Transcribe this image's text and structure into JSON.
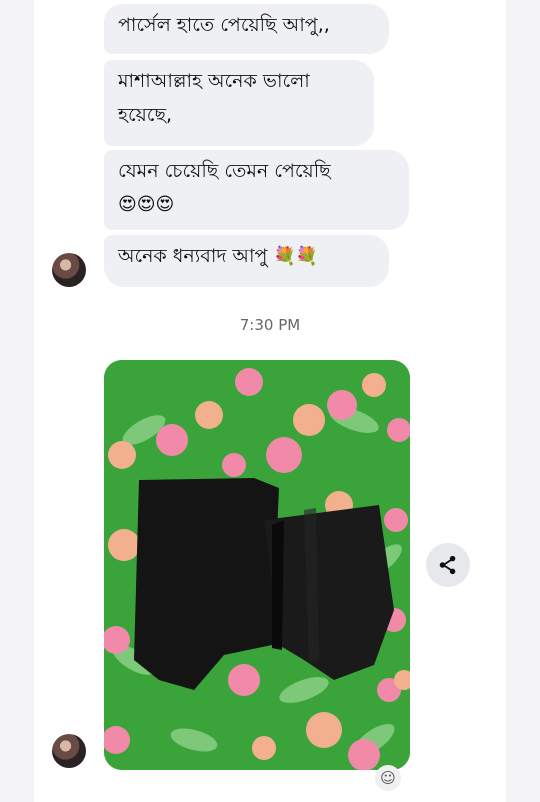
{
  "messages": [
    {
      "text": "পার্সেল হাতে পেয়েছি আপু,,"
    },
    {
      "line1": "মাশাআল্লাহ অনেক ভালো",
      "line2": "হয়েছে,"
    },
    {
      "line1": "যেমন চেয়েছি তেমন পেয়েছি",
      "emojis": "😍😍😍"
    },
    {
      "text": "অনেক ধন্যবাদ আপু",
      "emojis": "💐💐"
    }
  ],
  "timestamp": "7:30 PM",
  "icons": {
    "share": "share-icon",
    "react": "add-reaction-icon",
    "avatar": "avatar"
  },
  "colors": {
    "bubble": "#eef0f3",
    "photo_background": "#3fa83b",
    "fabric": "#141414"
  }
}
